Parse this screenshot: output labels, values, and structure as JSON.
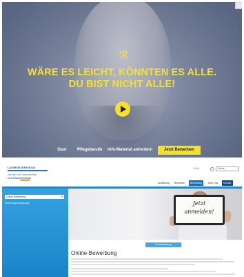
{
  "hero": {
    "headline_line1": "WÄRE ES LEICHT, KÖNNTEN ES ALLE.",
    "headline_line2": "DU BIST NICHT ALLE!",
    "logo_glyph": "ℛ",
    "accent_color": "#f5e030",
    "nav": {
      "start": "Start",
      "pflegeberufe": "Pflegeberufe",
      "info_material": "Info-Material anfordern",
      "apply_cta": "Jetzt Bewerben"
    }
  },
  "site": {
    "brand_line1": "Landeskrankenhaus",
    "brand_line2": "Schulen für Gesundheits-",
    "brand_line3": "und Krankenpflege",
    "search": {
      "zone": "A A A",
      "value": "Suche"
    },
    "top_nav": [
      "Ausbildung",
      "Bewerben",
      "Bewerbung",
      "Über Uns",
      "Kontakt"
    ],
    "active_tab": "Bewerbung",
    "sidebar": {
      "select_value": "Online-Bewerbung",
      "link": "Bewerbungsbedingungen"
    },
    "sign": {
      "line1": "Jetzt",
      "line2": "anmelden!"
    },
    "apply_button": "Zur Bewerbung",
    "page_title": "Online-Bewerbung",
    "accent_color": "#1e6db7"
  }
}
